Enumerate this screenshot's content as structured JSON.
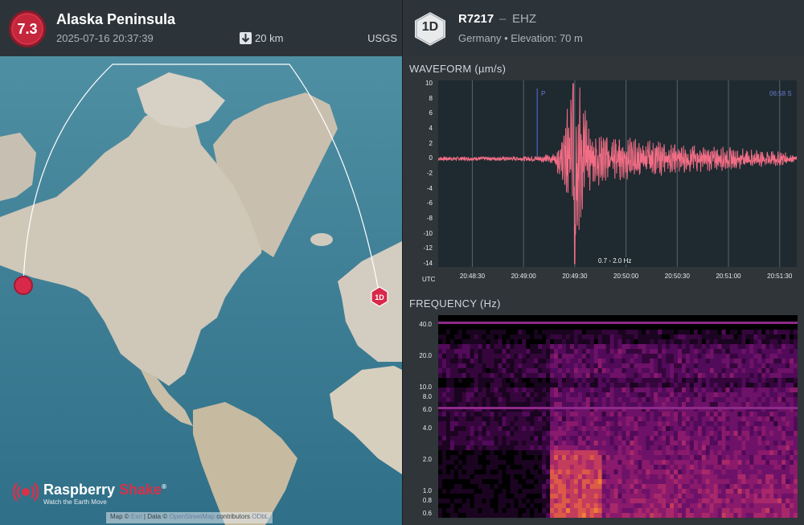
{
  "event": {
    "magnitude": "7.3",
    "title": "Alaska Peninsula",
    "datetime": "2025-07-16 20:37:39",
    "depth": "20 km",
    "source": "USGS",
    "badge_color": "#c4263c"
  },
  "map": {
    "station_marker_label": "1D",
    "attribution": {
      "prefix": "Map ©",
      "link1": "Esri",
      "mid": " | Data ©",
      "link2": "OpenStreetMap",
      "suffix": " contributors",
      "link3": "ODbL"
    },
    "brand": {
      "name_part1": "Raspberry ",
      "name_part2": "Shake",
      "registered": "®",
      "tagline": "Watch the Earth Move"
    }
  },
  "station": {
    "badge_label": "1D",
    "code": "R7217",
    "separator": "–",
    "channel": "EHZ",
    "location": "Germany • Elevation: 70 m"
  },
  "waveform": {
    "title": "WAVEFORM (µm/s)",
    "y_ticks": [
      "10",
      "8",
      "6",
      "4",
      "2",
      "0",
      "-2",
      "-4",
      "-6",
      "-8",
      "-10",
      "-12",
      "-14"
    ],
    "x_ticks": [
      "20:48:30",
      "20:49:00",
      "20:49:30",
      "20:50:00",
      "20:50:30",
      "20:51:00",
      "20:51:30"
    ],
    "utc_label": "UTC",
    "band_label": "0.7 - 2.0 Hz",
    "p_label": "P",
    "s_label": "06:58 S",
    "trace_color": "#f26d85"
  },
  "frequency": {
    "title": "FREQUENCY (Hz)",
    "y_ticks": [
      "40.0",
      "20.0",
      "10.0",
      "8.0",
      "6.0",
      "4.0",
      "2.0",
      "1.0",
      "0.8",
      "0.6"
    ]
  },
  "chart_data": {
    "type": "line",
    "title": "WAVEFORM (µm/s)",
    "xlabel": "UTC",
    "ylabel": "µm/s",
    "ylim": [
      -14,
      10
    ],
    "xlim": [
      "20:48:10",
      "20:51:40"
    ],
    "grid": true,
    "series": [
      {
        "x": [
          "20:48:10",
          "20:48:30",
          "20:49:00",
          "20:49:18",
          "20:49:24",
          "20:49:28",
          "20:49:30",
          "20:49:40",
          "20:50:00",
          "20:50:30",
          "20:51:00",
          "20:51:30",
          "20:51:40"
        ],
        "values": [
          0,
          0,
          0,
          0.5,
          5,
          12,
          -14,
          4,
          -3,
          2,
          -1.5,
          1,
          0
        ]
      }
    ]
  }
}
